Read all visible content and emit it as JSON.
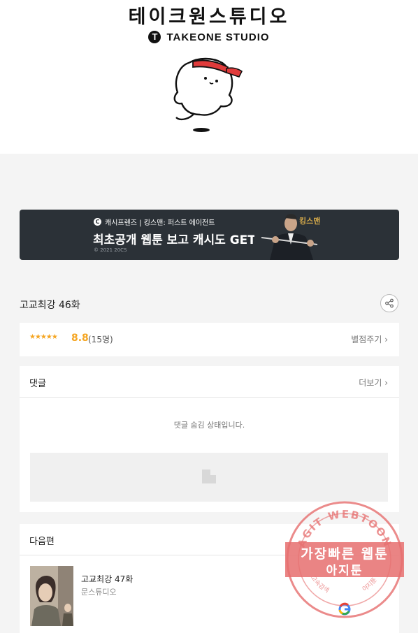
{
  "studio": {
    "name_ko": "테이크원스튜디오",
    "name_en": "TAKEONE STUDIO",
    "logo_mark": "T"
  },
  "banner": {
    "brand": "캐시프렌즈 | 킹스맨: 퍼스트 에이전트",
    "headline": "최초공개 웹툰 보고 캐시도 GET!",
    "copyright": "© 2021 20CS",
    "movie_title": "킹스맨"
  },
  "episode": {
    "title": "고교최강 46화"
  },
  "rating": {
    "stars": "★★★★★",
    "score": "8.8",
    "count": "(15명)",
    "rate_link": "별점주기 ›"
  },
  "comments": {
    "title": "댓글",
    "more": "더보기 ›",
    "hidden_note": "댓글 숨김 상태입니다."
  },
  "next": {
    "section_title": "다음편",
    "title": "고교최강 47화",
    "author": "문스튜디오"
  },
  "watermark": {
    "line1": "가장빠른 웹툰",
    "line2": "아지툰",
    "ring_text": "AGIT WEBTOON",
    "bottom_left": "고속검색",
    "bottom_right": "아지툰"
  },
  "colors": {
    "accent_star": "#f5a623",
    "banner_bg": "#2b3137",
    "stamp_red": "#e66e6e"
  },
  "icons": [
    "share-icon",
    "chevron-right-icon",
    "image-placeholder-icon",
    "google-icon"
  ]
}
